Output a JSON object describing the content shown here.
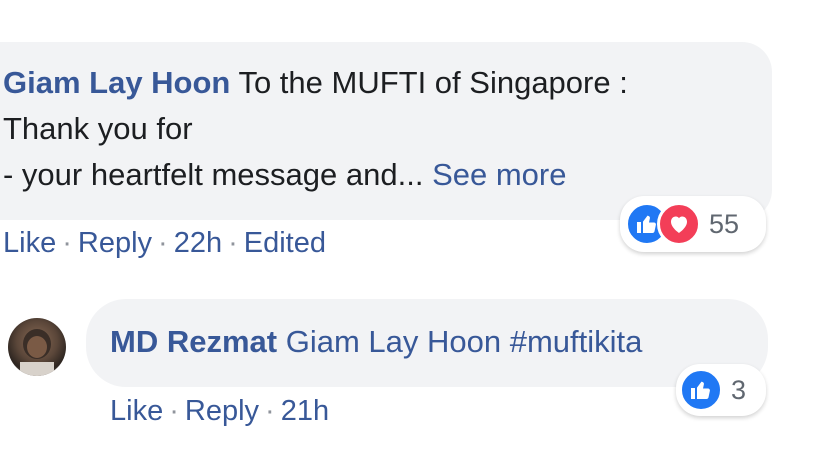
{
  "comment1": {
    "author": "Giam Lay Hoon",
    "line1": "To the MUFTI of Singapore :",
    "line2": "Thank you for",
    "line3": "- your heartfelt message and...",
    "see_more": "See more",
    "actions": {
      "like": "Like",
      "reply": "Reply",
      "time": "22h",
      "edited": "Edited"
    },
    "reactions": {
      "count": "55",
      "icons": [
        "like-icon",
        "love-icon"
      ]
    }
  },
  "comment2": {
    "author": "MD Rezmat",
    "mention": "Giam Lay Hoon",
    "text": "#muftikita",
    "actions": {
      "like": "Like",
      "reply": "Reply",
      "time": "21h"
    },
    "reactions": {
      "count": "3",
      "icons": [
        "like-icon"
      ]
    }
  },
  "colors": {
    "link": "#385898",
    "bubble": "#f2f3f5",
    "meta": "#606770",
    "like_blue": "#2078f4",
    "love_red": "#f33e58"
  }
}
